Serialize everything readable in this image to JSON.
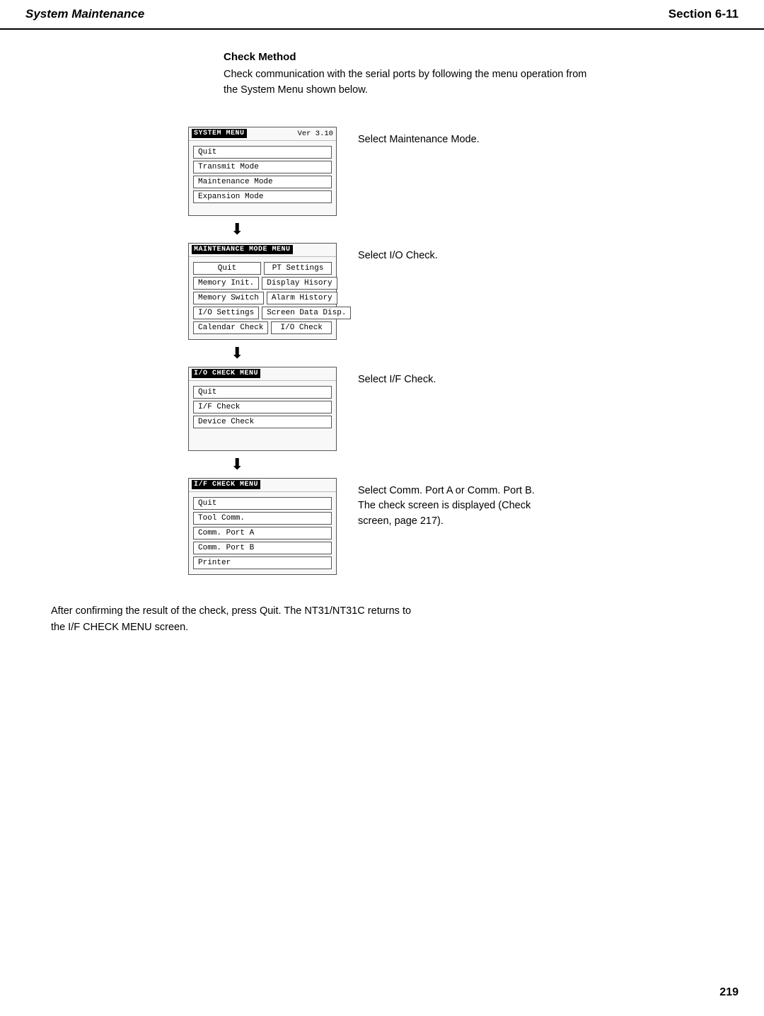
{
  "header": {
    "left": "System Maintenance",
    "right": "Section  6-11"
  },
  "section": {
    "heading": "Check Method",
    "body_line1": "Check communication with the serial ports by following the menu operation from",
    "body_line2": "the System Menu shown below."
  },
  "screens": [
    {
      "id": "system-menu",
      "title_highlight": "SYSTEM MENU",
      "version": "Ver 3.10",
      "buttons": [
        "Quit",
        "Transmit Mode",
        "Maintenance Mode",
        "Expansion Mode"
      ],
      "button_rows": null
    },
    {
      "id": "maintenance-menu",
      "title_highlight": "MAINTENANCE MODE MENU",
      "version": null,
      "buttons": null,
      "button_rows": [
        [
          "Quit",
          "PT Settings"
        ],
        [
          "Memory Init.",
          "Display Hisory"
        ],
        [
          "Memory Switch",
          "Alarm History"
        ],
        [
          "I/O Settings",
          "Screen Data Disp."
        ],
        [
          "Calendar Check",
          "I/O Check"
        ]
      ]
    },
    {
      "id": "io-check-menu",
      "title_highlight": "I/O CHECK MENU",
      "version": null,
      "buttons": [
        "Quit",
        "I/F Check",
        "Device Check"
      ],
      "button_rows": null
    },
    {
      "id": "if-check-menu",
      "title_highlight": "I/F CHECK MENU",
      "version": null,
      "buttons": [
        "Quit",
        "Tool Comm.",
        "Comm. Port A",
        "Comm. Port B",
        "Printer"
      ],
      "button_rows": null
    }
  ],
  "step_labels": [
    "Select Maintenance Mode.",
    "Select I/O Check.",
    "Select I/F Check.",
    "Select Comm. Port A or Comm. Port B.\nThe check screen is displayed (Check screen, page 217)."
  ],
  "footer": {
    "line1": "After confirming the result of the check, press Quit. The NT31/NT31C returns to",
    "line2": "the I/F CHECK MENU screen."
  },
  "page_number": "219"
}
